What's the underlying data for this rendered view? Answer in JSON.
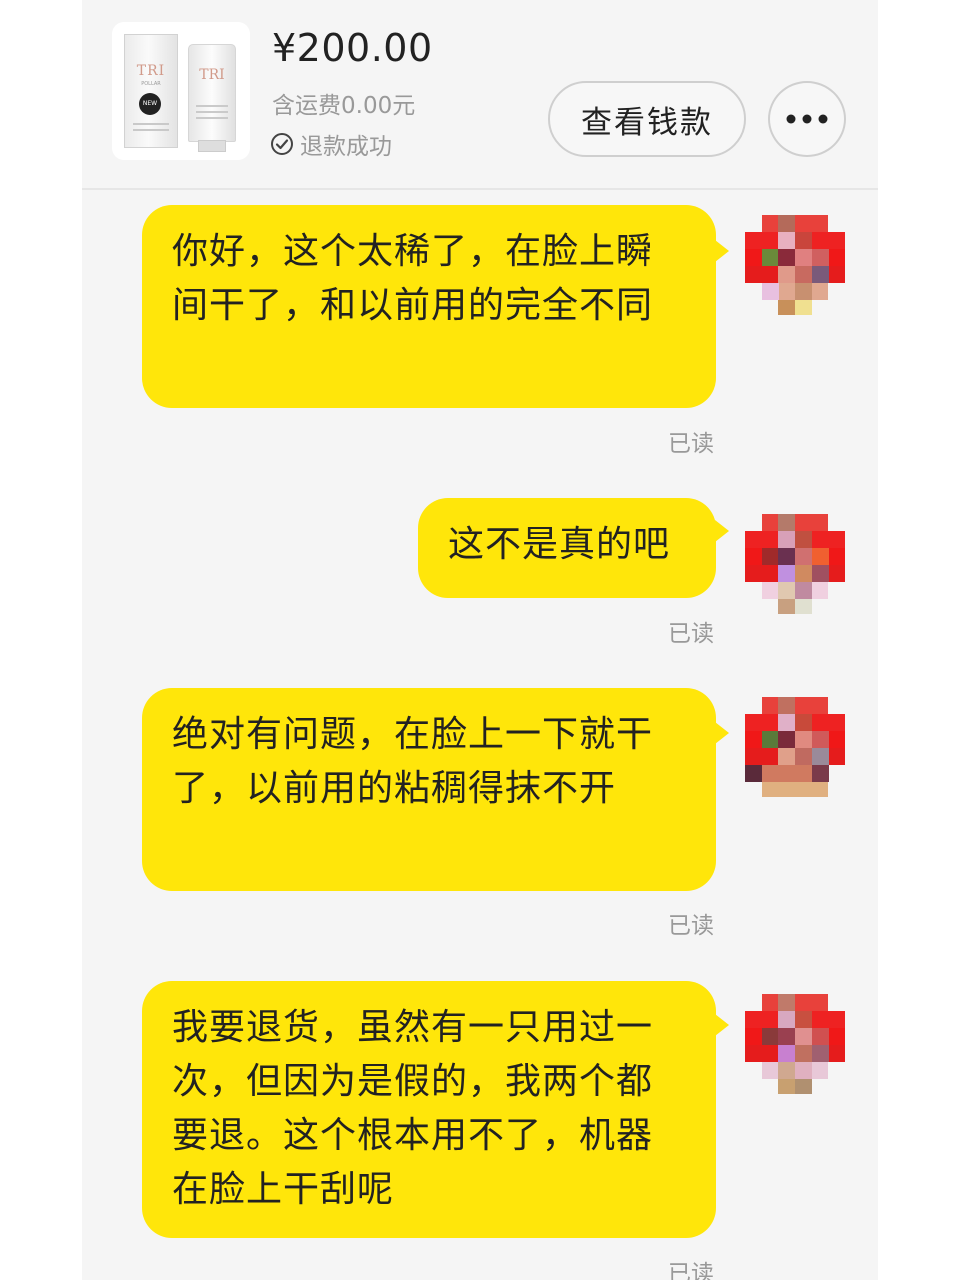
{
  "product": {
    "thumbnail_brand": "TRI",
    "thumbnail_sub": "POLLAR",
    "thumbnail_badge": "NEW",
    "price": "¥200.00",
    "shipping": "含运费0.00元",
    "status": "退款成功",
    "status_icon": "check-circle-icon"
  },
  "actions": {
    "view_money": "查看钱款",
    "more": "•••",
    "more_icon": "more-icon"
  },
  "messages": [
    {
      "text": "你好，这个太稀了，在脸上瞬间干了，和以前用的完全不同",
      "read": "已读"
    },
    {
      "text": "这不是真的吧",
      "read": "已读"
    },
    {
      "text": "绝对有问题，在脸上一下就干了，以前用的粘稠得抹不开",
      "read": "已读"
    },
    {
      "text": "我要退货，虽然有一只用过一次，但因为是假的，我两个都要退。这个根本用不了，机器在脸上干刮呢",
      "read": "已读"
    }
  ],
  "colors": {
    "bubble": "#ffe60a",
    "background": "#f5f5f5",
    "muted_text": "#999999"
  }
}
